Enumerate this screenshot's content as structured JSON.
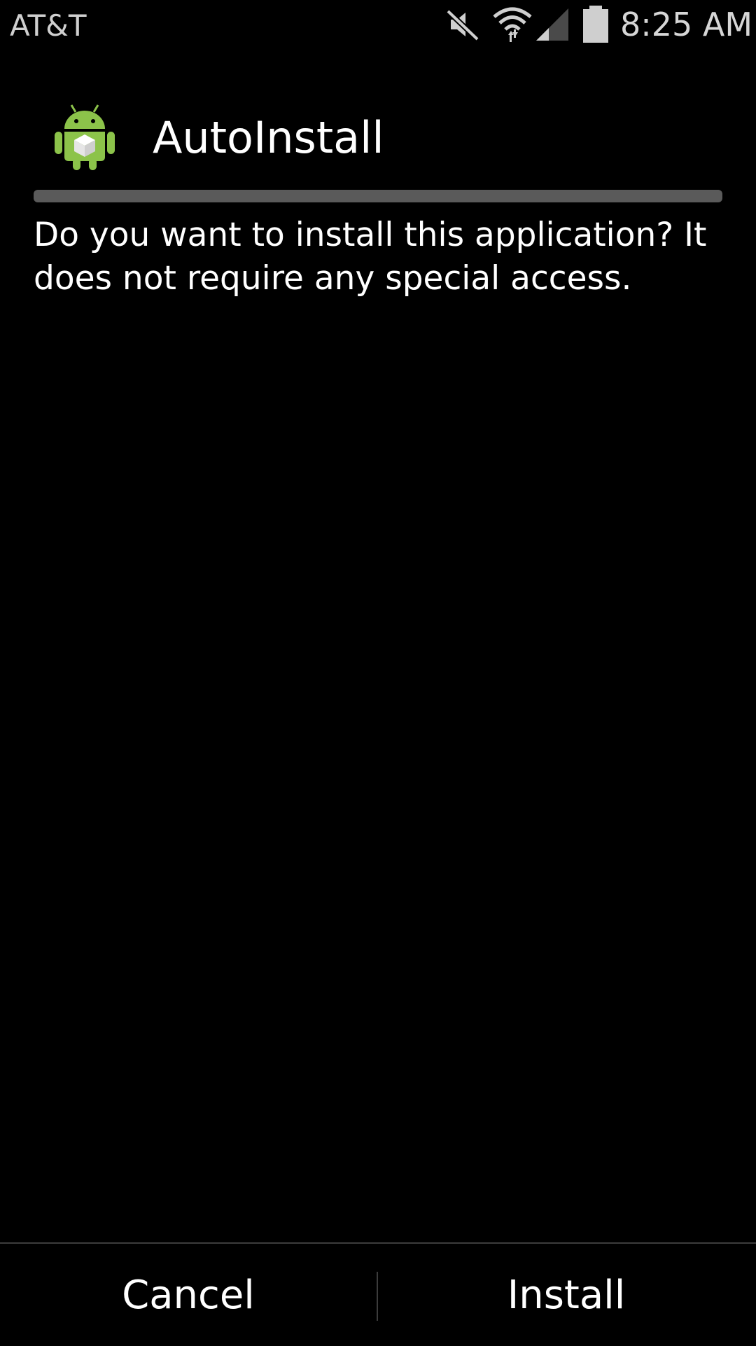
{
  "status_bar": {
    "carrier": "AT&T",
    "time": "8:25 AM",
    "icons": [
      "mute-icon",
      "wifi-icon",
      "signal-icon",
      "battery-icon"
    ]
  },
  "dialog": {
    "app_name": "AutoInstall",
    "app_icon": "android-package-icon",
    "message": "Do you want to install this application? It does not require any special access."
  },
  "buttons": {
    "cancel_label": "Cancel",
    "install_label": "Install"
  },
  "colors": {
    "background": "#000000",
    "text": "#ffffff",
    "divider": "#5a5a5a",
    "android_green": "#8cc34a"
  }
}
